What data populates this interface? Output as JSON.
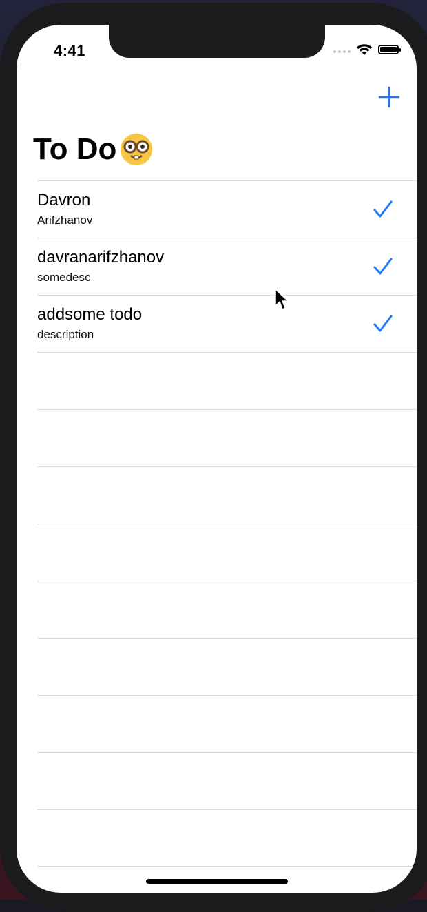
{
  "status_bar": {
    "time": "4:41",
    "icons": [
      "signal-dots-icon",
      "wifi-icon",
      "battery-icon"
    ]
  },
  "nav": {
    "add_icon": "plus-icon",
    "title": "To Do",
    "title_emoji": "nerd-face-icon"
  },
  "colors": {
    "accent": "#1e7cf2",
    "separator": "#dcdce0"
  },
  "todos": [
    {
      "title": "Davron",
      "subtitle": "Arifzhanov",
      "done": true
    },
    {
      "title": "davranarifzhanov",
      "subtitle": "somedesc",
      "done": true
    },
    {
      "title": "addsome todo",
      "subtitle": "description",
      "done": true
    }
  ]
}
